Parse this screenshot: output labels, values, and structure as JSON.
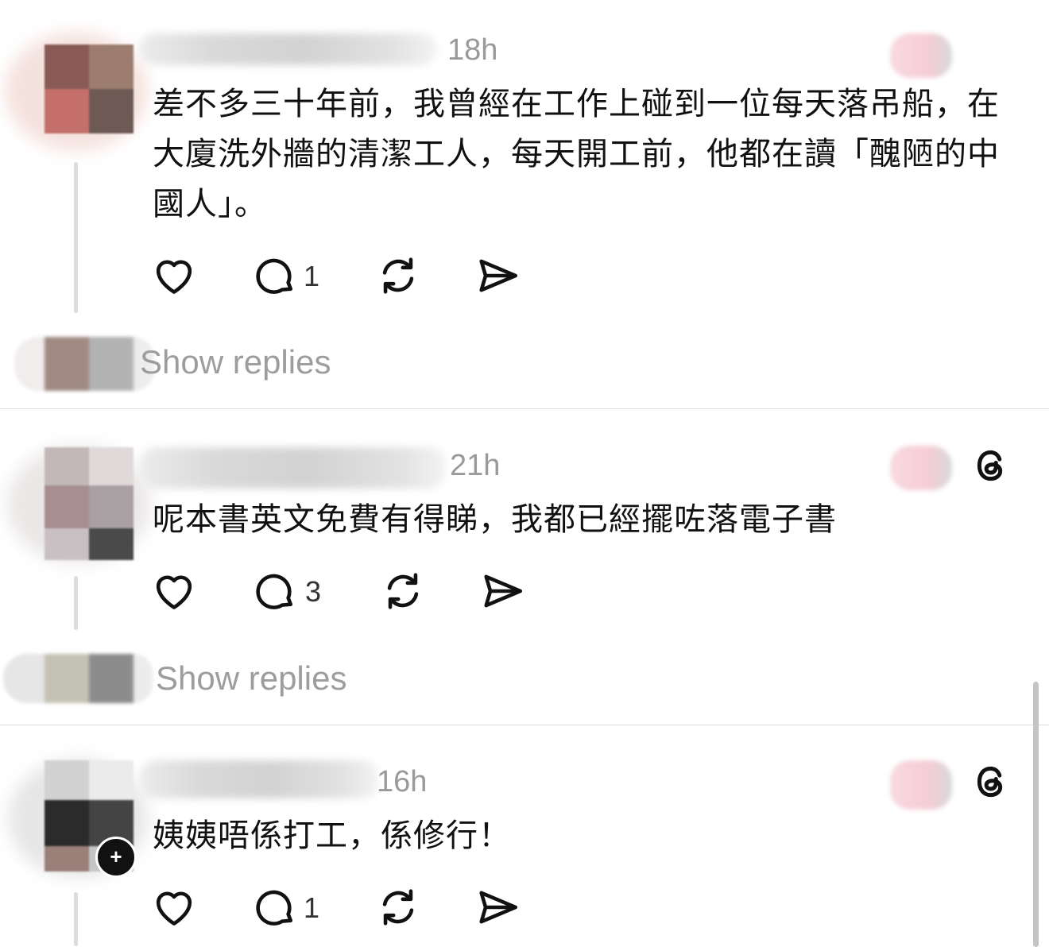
{
  "comments": [
    {
      "time": "18h",
      "text": "差不多三十年前，我曾經在工作上碰到一位每天落吊船，在大廈洗外牆的清潔工人，每天開工前，他都在讀「醜陋的中國人」。",
      "reply_count": "1",
      "show_replies": "Show replies",
      "colors": {
        "avatar": [
          "#8a5a55",
          "#9c7d70",
          "#c46f6a",
          "#6e5a54"
        ]
      }
    },
    {
      "time": "21h",
      "text": "呢本書英文免費有得睇，我都已經擺咗落電子書",
      "reply_count": "3",
      "show_replies": "Show replies",
      "colors": {
        "avatar": [
          "#c2b8b8",
          "#e0d9d9",
          "#a78e90",
          "#a8a0a3",
          "#c9c0c4",
          "#4a4a4a"
        ]
      }
    },
    {
      "time": "16h",
      "text": "姨姨唔係打工，係修行！",
      "reply_count": "1",
      "colors": {
        "avatar": [
          "#d2d2d2",
          "#ebebeb",
          "#2b2b2b",
          "#444444",
          "#9a8079",
          "#c5c5c5"
        ]
      }
    }
  ],
  "icons": [
    "heart-icon",
    "comment-icon",
    "repost-icon",
    "share-icon",
    "threads-logo-icon"
  ]
}
